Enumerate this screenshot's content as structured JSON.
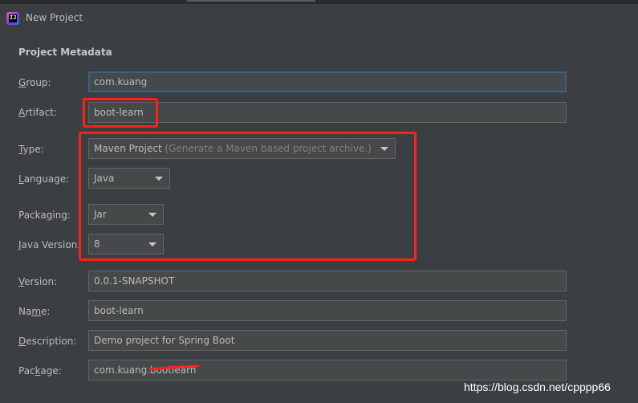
{
  "window": {
    "title": "New Project"
  },
  "section": {
    "title": "Project Metadata"
  },
  "fields": {
    "group": {
      "label_mnemonic": "G",
      "label_rest": "roup:",
      "value": "com.kuang"
    },
    "artifact": {
      "label_mnemonic": "A",
      "label_rest": "rtifact:",
      "value": "boot-learn"
    },
    "type": {
      "label_mnemonic": "T",
      "label_rest": "ype:",
      "value": "Maven Project",
      "hint": "(Generate a Maven based project archive.)"
    },
    "language": {
      "label_mnemonic": "L",
      "label_rest": "anguage:",
      "value": "Java"
    },
    "packaging": {
      "label_pre": "Packa",
      "label_mnemonic": "g",
      "label_post": "ing:",
      "value": "Jar"
    },
    "java_version": {
      "label_mnemonic": "J",
      "label_rest": "ava Version:",
      "value": "8"
    },
    "version": {
      "label_mnemonic": "V",
      "label_rest": "ersion:",
      "value": "0.0.1-SNAPSHOT"
    },
    "name": {
      "label_pre": "Na",
      "label_mnemonic": "m",
      "label_post": "e:",
      "value": "boot-learn"
    },
    "description": {
      "label_mnemonic": "D",
      "label_rest": "escription:",
      "value": "Demo project for Spring Boot"
    },
    "package": {
      "label_pre": "Pac",
      "label_mnemonic": "k",
      "label_post": "age:",
      "value": "com.kuang.bootlearn"
    }
  },
  "watermark": "https://blog.csdn.net/cpppp66",
  "colors": {
    "background": "#3c3f41",
    "field_background": "#45494a",
    "field_border": "#646464",
    "focus_border": "#3d6185",
    "text": "#bbbbbb",
    "hint": "#808080",
    "annotation_red": "#ff1f1f"
  },
  "icons": {
    "app": "intellij-idea-icon",
    "dropdown": "chevron-down-icon"
  }
}
